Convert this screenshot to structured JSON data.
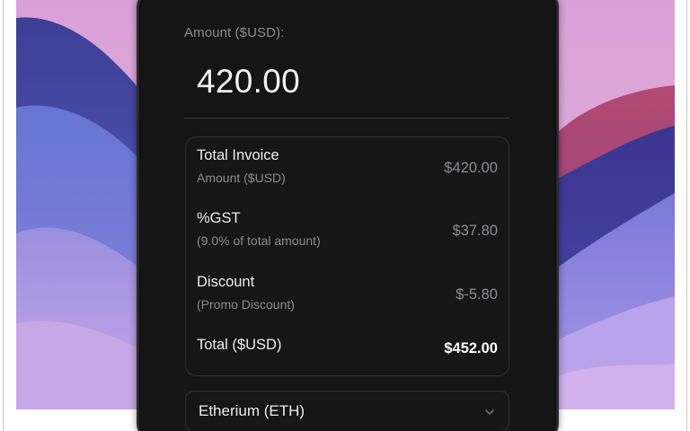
{
  "form": {
    "amount_label": "Amount ($USD):",
    "amount_value": "420.00"
  },
  "summary": {
    "rows": [
      {
        "title": "Total Invoice",
        "subtitle": "Amount ($USD)",
        "value": "$420.00"
      },
      {
        "title": "%GST",
        "subtitle": "(9.0% of total amount)",
        "value": "$37.80"
      },
      {
        "title": "Discount",
        "subtitle": "(Promo Discount)",
        "value": "$-5.80"
      }
    ],
    "total": {
      "title": "Total ($USD)",
      "value": "$452.00"
    }
  },
  "currency": {
    "selected": "Etherium (ETH)",
    "icon": "chevron-down-icon"
  },
  "colors": {
    "panel_bg": "#151515",
    "card_border": "#333336",
    "text_primary": "#ececec",
    "text_muted": "#8a8a8e"
  }
}
